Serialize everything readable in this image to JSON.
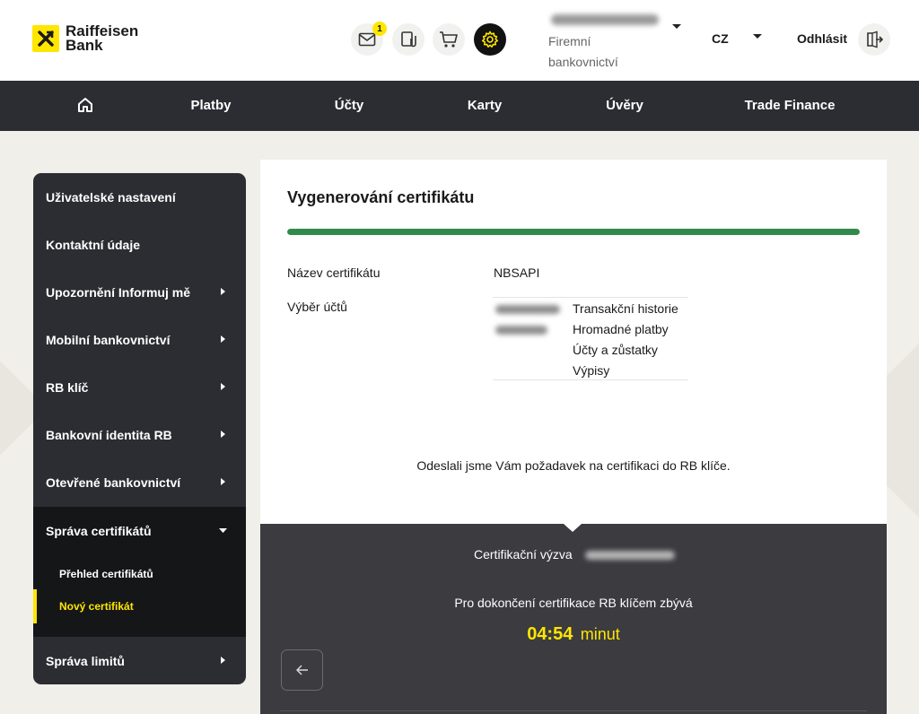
{
  "brand": {
    "line1": "Raiffeisen",
    "line2": "Bank",
    "accent_color": "#fee600"
  },
  "header": {
    "icons": [
      "mail-icon",
      "documents-icon",
      "cart-icon",
      "settings-icon"
    ],
    "mail_badge": "1",
    "user_role": "Firemní bankovnictví",
    "language": "CZ",
    "logout_label": "Odhlásit"
  },
  "topnav": {
    "items": [
      "Platby",
      "Účty",
      "Karty",
      "Úvěry",
      "Trade Finance"
    ]
  },
  "sidebar": {
    "items": [
      "Uživatelské nastavení",
      "Kontaktní údaje",
      "Upozornění Informuj mě",
      "Mobilní bankovnictví",
      "RB klíč",
      "Bankovní identita RB",
      "Otevřené bankovnictví"
    ],
    "expanded": "Správa certifikátů",
    "sub_items": [
      "Přehled certifikátů",
      "Nový certifikát"
    ],
    "active_sub": "Nový certifikát",
    "last_item": "Správa limitů"
  },
  "main": {
    "title": "Vygenerování certifikátu",
    "progress_percent": 100,
    "progress_color": "#2f8a4c",
    "cert_name_label": "Název certifikátu",
    "cert_name_value": "NBSAPI",
    "accounts_label": "Výběr účtů",
    "permissions": [
      "Transakční historie",
      "Hromadné platby",
      "Účty a zůstatky",
      "Výpisy"
    ],
    "info": "Odeslali jsme Vám požadavek na certifikaci do RB klíče."
  },
  "challenge": {
    "label": "Certifikační výzva",
    "remaining": "Pro dokončení certifikace RB klíčem zbývá",
    "time": "04:54",
    "unit": "minut"
  }
}
